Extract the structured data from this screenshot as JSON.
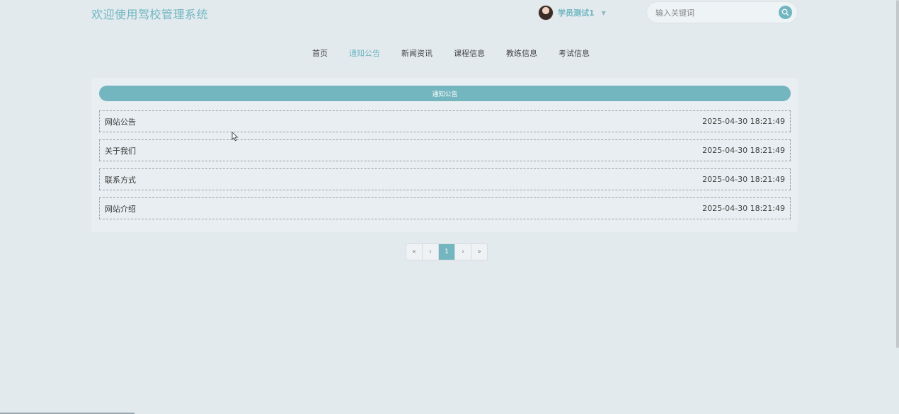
{
  "header": {
    "site_title": "欢迎使用驾校管理系统",
    "user": {
      "name": "学员测试1",
      "avatar_icon": "user-avatar-photo",
      "caret_icon": "caret-down-icon"
    },
    "search": {
      "placeholder": "输入关键词",
      "button_icon": "search-icon"
    }
  },
  "nav": {
    "items": [
      {
        "label": "首页"
      },
      {
        "label": "通知公告"
      },
      {
        "label": "新闻资讯"
      },
      {
        "label": "课程信息"
      },
      {
        "label": "教练信息"
      },
      {
        "label": "考试信息"
      }
    ],
    "active": "通知公告"
  },
  "panel": {
    "title": "通知公告",
    "notices": [
      {
        "title": "网站公告",
        "date": "2025-04-30 18:21:49"
      },
      {
        "title": "关于我们",
        "date": "2025-04-30 18:21:49"
      },
      {
        "title": "联系方式",
        "date": "2025-04-30 18:21:49"
      },
      {
        "title": "网站介绍",
        "date": "2025-04-30 18:21:49"
      }
    ]
  },
  "pagination": {
    "first": "«",
    "prev": "‹",
    "current": "1",
    "next": "›",
    "last": "»"
  },
  "colors": {
    "accent": "#6fb6c1",
    "background": "#e3eaee"
  }
}
